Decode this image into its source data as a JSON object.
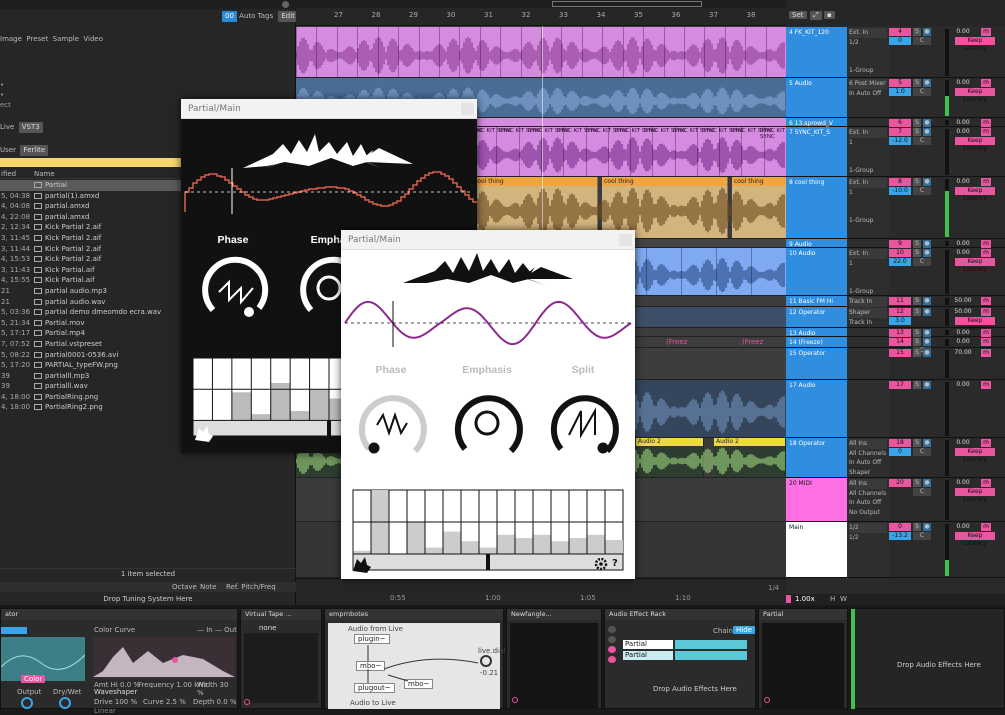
{
  "browser": {
    "top_tabs": [
      "Image",
      "Preset",
      "Sample",
      "Video"
    ],
    "auto_tags_label": "Auto Tags",
    "edit_label": "Edit",
    "formats": [
      "Live",
      "VST3"
    ],
    "user_tabs": [
      "User",
      "Ferlite"
    ],
    "col_modified": "ified",
    "col_name": "Name",
    "files": [
      {
        "d": "",
        "n": "Partial",
        "folder": true,
        "selected": true
      },
      {
        "d": "5, 04:38",
        "n": "partial(1).amxd",
        "folder": true
      },
      {
        "d": "4, 04:08",
        "n": "partial.amxd",
        "folder": true
      },
      {
        "d": "4, 22:08",
        "n": "partial.amxd",
        "folder": true
      },
      {
        "d": "2, 12:34",
        "n": "Kick Partial 2.aif"
      },
      {
        "d": "3, 11:45",
        "n": "Kick Partial 2.aif"
      },
      {
        "d": "3, 11:44",
        "n": "Kick Partial 2.aif"
      },
      {
        "d": "4, 15:53",
        "n": "Kick Partial 2.aif"
      },
      {
        "d": "3, 11:43",
        "n": "Kick Partial.aif"
      },
      {
        "d": "4, 15:55",
        "n": "Kick Partial.aif"
      },
      {
        "d": "21",
        "n": "partial audio.mp3"
      },
      {
        "d": "21",
        "n": "partial audio.wav"
      },
      {
        "d": "5, 03:36",
        "n": "partial demo dmeomdo ecra.wav"
      },
      {
        "d": "5, 21:34",
        "n": "Partial.mov"
      },
      {
        "d": "5, 17:17",
        "n": "Partial.mp4"
      },
      {
        "d": "7, 07:52",
        "n": "Partial.vstpreset"
      },
      {
        "d": "5, 08:22",
        "n": "partial0001-0536.avi"
      },
      {
        "d": "5, 17:20",
        "n": "PARTIAL_typeFW.png"
      },
      {
        "d": "39",
        "n": "partialll.mp3"
      },
      {
        "d": "39",
        "n": "partialll.wav"
      },
      {
        "d": "4, 18:00",
        "n": "PartialRing.png"
      },
      {
        "d": "4, 18:00",
        "n": "PartialRing2.png"
      }
    ],
    "status": "1 item selected",
    "tuning_tabs": [
      "Octave",
      "Note",
      "Ref. Pitch/Freq"
    ],
    "drop_tuning": "Drop Tuning System Here"
  },
  "arrangement": {
    "bars": [
      "27",
      "28",
      "29",
      "30",
      "31",
      "32",
      "33",
      "34",
      "35",
      "36",
      "37",
      "38"
    ],
    "set_label": "Set",
    "times": [
      "0:55",
      "1:00",
      "1:05",
      "1:10"
    ],
    "page": "1/4",
    "zoom": "1.00x",
    "sync_text": "SYNC KIT SYNC",
    "cool_thing": "cool thing",
    "audio2": "Audio 2",
    "freeze": "(Freez"
  },
  "tracks": [
    {
      "name": "4 FK_KIT_120",
      "color": "#7f91ff",
      "io": [
        "Ext. In",
        "1/2",
        "",
        "",
        "1-Group"
      ],
      "num": "4",
      "vol": "0",
      "pan": "C",
      "val": "0.00",
      "lat": "Keep Latency",
      "meter": 0
    },
    {
      "name": "5 Audio",
      "color": "#7f91ff",
      "io": [
        "6 Post Mixer",
        "In Auto Off"
      ],
      "num": "5",
      "vol": "1.0",
      "pan": "C",
      "val": "0.00",
      "lat": "Keep Latency",
      "meter": 0.55
    },
    {
      "name": "6 13.sprowd_V",
      "color": "#7f91ff",
      "io": [],
      "num": "6",
      "vol": "",
      "pan": "",
      "val": "0.00",
      "lat": "",
      "meter": 0
    },
    {
      "name": "7 SYNC_KIT_S",
      "color": "#7f91ff",
      "io": [
        "Ext. In",
        "1",
        "",
        "",
        "1-Group"
      ],
      "num": "7",
      "vol": "-12.0",
      "pan": "C",
      "val": "0.00",
      "lat": "Keep Latency",
      "meter": 0
    },
    {
      "name": "8 cool thing",
      "color": "#7f91ff",
      "io": [
        "Ext. In",
        "1",
        "",
        "",
        "1-Group"
      ],
      "num": "8",
      "vol": "-10.0",
      "pan": "C",
      "val": "0.00",
      "lat": "Keep Latency",
      "meter": 0.8
    },
    {
      "name": "9 Audio",
      "color": "#7f91ff",
      "io": [],
      "num": "9",
      "vol": "",
      "pan": "",
      "val": "0.00",
      "lat": "",
      "meter": 0
    },
    {
      "name": "10 Audio",
      "color": "#7f91ff",
      "io": [
        "Ext. In",
        "1",
        "",
        "",
        "1-Group"
      ],
      "num": "10",
      "vol": "22.0",
      "pan": "C",
      "val": "0.00",
      "lat": "Keep Latency",
      "meter": 0
    },
    {
      "name": "11 Basic FM Hi",
      "color": "#7f91ff",
      "io": [
        "Track In"
      ],
      "num": "11",
      "vol": "",
      "pan": "",
      "val": "50.00",
      "lat": "",
      "meter": 0
    },
    {
      "name": "12 Operator",
      "color": "#7f91ff",
      "io": [
        "Shaper",
        "Track In"
      ],
      "num": "12",
      "vol": "3.0",
      "pan": "",
      "val": "50.00",
      "lat": "Keep Latency",
      "meter": 0
    },
    {
      "name": "13 Audio",
      "color": "#7f91ff",
      "io": [],
      "num": "13",
      "vol": "",
      "pan": "",
      "val": "0.00",
      "lat": "",
      "meter": 0
    },
    {
      "name": "14 (Freeze)",
      "color": "#7f91ff",
      "io": [],
      "num": "14",
      "vol": "",
      "pan": "C",
      "val": "0.00",
      "lat": "",
      "meter": 0
    },
    {
      "name": "15 Operator",
      "color": "#7f91ff",
      "io": [],
      "num": "15",
      "vol": "",
      "pan": "",
      "val": "70.00",
      "lat": "",
      "meter": 0
    },
    {
      "name": "16 Blades short",
      "color": "#7f91ff",
      "io": [],
      "num": "16",
      "vol": "",
      "pan": "",
      "val": "0.00",
      "lat": "",
      "meter": 0
    },
    {
      "name": "17 Audio",
      "color": "#7f91ff",
      "io": [],
      "num": "17",
      "vol": "",
      "pan": "",
      "val": "0.00",
      "lat": "",
      "meter": 0
    },
    {
      "name": "18 Operator",
      "color": "#7f91ff",
      "io": [
        "All Ins",
        "All Channels",
        "In Auto Off",
        "Shaper",
        "Track In"
      ],
      "num": "18",
      "vol": "0",
      "pan": "C",
      "val": "0.00",
      "lat": "Keep Latency",
      "meter": 0
    },
    {
      "name": "19 Audio",
      "color": "#7f91ff",
      "io": [
        "Post Mixer",
        "In Auto Off",
        "Shaper",
        "Track In"
      ],
      "num": "19",
      "vol": "-1.0",
      "pan": "C",
      "val": "0.00",
      "lat": "Keep Latency",
      "meter": 0.7
    },
    {
      "name": "20 MIDI",
      "color": "#ff6fe5",
      "io": [
        "All Ins",
        "All Channels",
        "In Auto Off",
        "No Output"
      ],
      "num": "20",
      "vol": "",
      "pan": "C",
      "val": "0.00",
      "lat": "Keep Latency",
      "meter": 0
    },
    {
      "name": "Main",
      "color": "#ffffff",
      "io": [
        "1/2",
        "1/2"
      ],
      "num": "0",
      "vol": "-13.2",
      "pan": "C",
      "val": "0.00",
      "lat": "Keep Latency",
      "meter": 0.3
    }
  ],
  "devices": {
    "d1_title": "ator",
    "color_curve": "Color Curve",
    "in_out": "— In — Out",
    "color_btn": "Color",
    "amt_hi": "Amt Hi 0.0 %",
    "frequency": "Frequency 1.00 kHz",
    "width": "Width 30 %",
    "output_label": "Output",
    "drywet_label": "Dry/Wet",
    "waveshaper_label": "Waveshaper",
    "drive": "Drive 100 %",
    "curve": "Curve 2.5 %",
    "depth": "Depth 0.0 %",
    "linear": "Linear",
    "d2_title": "Virtual Tape ...",
    "d2_none": "none",
    "d3_title": "emprnbotes",
    "audio_from_live": "Audio from Live",
    "plugin_label": "plugin~",
    "mbo_label": "mbo~",
    "plugout_label": "plugout~",
    "audio_to_live": "Audio to Live",
    "live_dial": "live.dial",
    "dial_val": "-0.21",
    "d4_title": "Newfangle...",
    "rack_title": "Audio Effect Rack",
    "chain_label": "Chain",
    "hide_label": "Hide",
    "chains": [
      "Partial",
      "Partial"
    ],
    "rack_drop": "Drop Audio Effects Here",
    "partial_title": "Partial",
    "main_drop": "Drop Audio Effects Here",
    "letter_h": "H",
    "letter_w": "W"
  },
  "plugin_back": {
    "title": "Partial/Main",
    "knobs": [
      "Phase",
      "Emphas"
    ]
  },
  "plugin_front": {
    "title": "Partial/Main",
    "knobs": [
      "Phase",
      "Emphasis",
      "Split"
    ],
    "help": "?"
  },
  "colors": {
    "accent": "#e9559e",
    "clip_pink": "#d58bdf",
    "clip_blue": "#7fa9f0",
    "clip_orange": "#f0a540",
    "clip_yellow": "#ecd944",
    "wave_purple": "#8d2a8f"
  }
}
